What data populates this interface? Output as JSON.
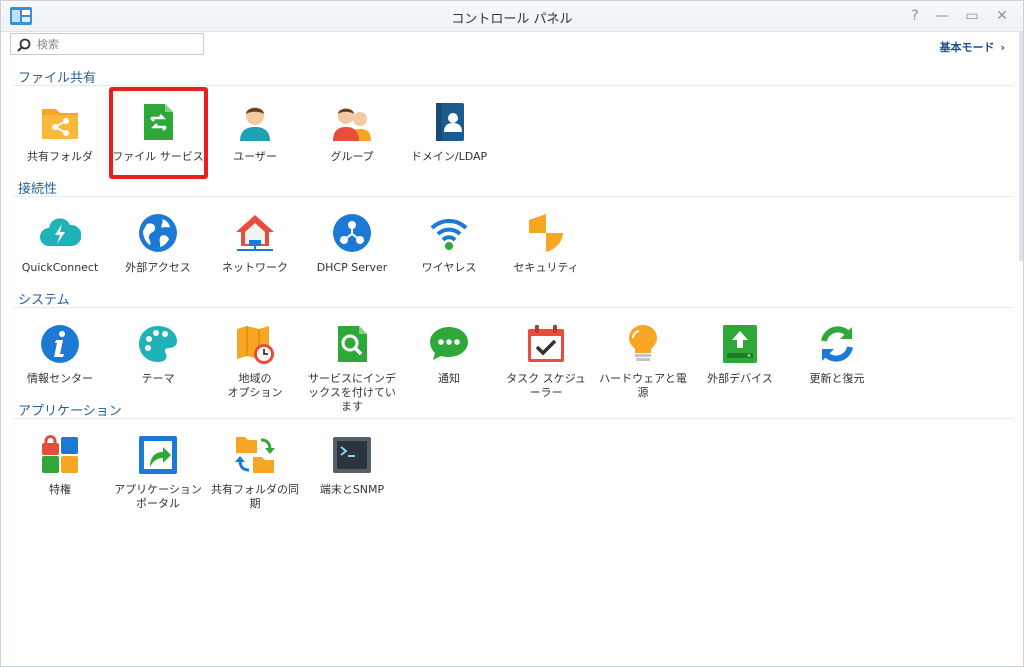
{
  "window": {
    "title": "コントロール パネル"
  },
  "controls": {
    "help": "?",
    "minimize": "—",
    "maximize": "▭",
    "close": "✕"
  },
  "search": {
    "placeholder": "検索",
    "value": ""
  },
  "mode_link": {
    "label": "基本モード",
    "chevron": "›"
  },
  "colors": {
    "accent_blue": "#1a7ad6",
    "highlight_red": "#ee1c1c",
    "section_blue": "#2a5e97"
  },
  "sections": [
    {
      "title": "ファイル共有",
      "items": [
        {
          "label": "共有フォルダ",
          "icon": "shared-folder-icon"
        },
        {
          "label": "ファイル サービス",
          "icon": "file-services-icon"
        },
        {
          "label": "ユーザー",
          "icon": "user-icon"
        },
        {
          "label": "グループ",
          "icon": "group-icon"
        },
        {
          "label": "ドメイン/LDAP",
          "icon": "domain-ldap-icon"
        }
      ]
    },
    {
      "title": "接続性",
      "items": [
        {
          "label": "QuickConnect",
          "icon": "quickconnect-icon"
        },
        {
          "label": "外部アクセス",
          "icon": "globe-icon"
        },
        {
          "label": "ネットワーク",
          "icon": "house-network-icon"
        },
        {
          "label": "DHCP Server",
          "icon": "dhcp-server-icon"
        },
        {
          "label": "ワイヤレス",
          "icon": "wifi-icon"
        },
        {
          "label": "セキュリティ",
          "icon": "shield-icon"
        }
      ]
    },
    {
      "title": "システム",
      "items": [
        {
          "label": "情報センター",
          "icon": "info-icon"
        },
        {
          "label": "テーマ",
          "icon": "palette-icon"
        },
        {
          "label": "地域の\nオプション",
          "icon": "map-clock-icon"
        },
        {
          "label": "サービスにインデ\nックスを付けてい\nます",
          "icon": "indexing-icon"
        },
        {
          "label": "通知",
          "icon": "chat-bubble-icon"
        },
        {
          "label": "タスク スケジュ\nーラー",
          "icon": "calendar-icon"
        },
        {
          "label": "ハードウェアと電\n源",
          "icon": "lightbulb-icon"
        },
        {
          "label": "外部デバイス",
          "icon": "external-device-icon"
        },
        {
          "label": "更新と復元",
          "icon": "refresh-icon"
        }
      ]
    },
    {
      "title": "アプリケーション",
      "items": [
        {
          "label": "特権",
          "icon": "privileges-icon"
        },
        {
          "label": "アプリケーション\nポータル",
          "icon": "app-portal-icon"
        },
        {
          "label": "共有フォルダの同\n期",
          "icon": "folder-sync-icon"
        },
        {
          "label": "端末とSNMP",
          "icon": "terminal-icon"
        }
      ]
    }
  ]
}
